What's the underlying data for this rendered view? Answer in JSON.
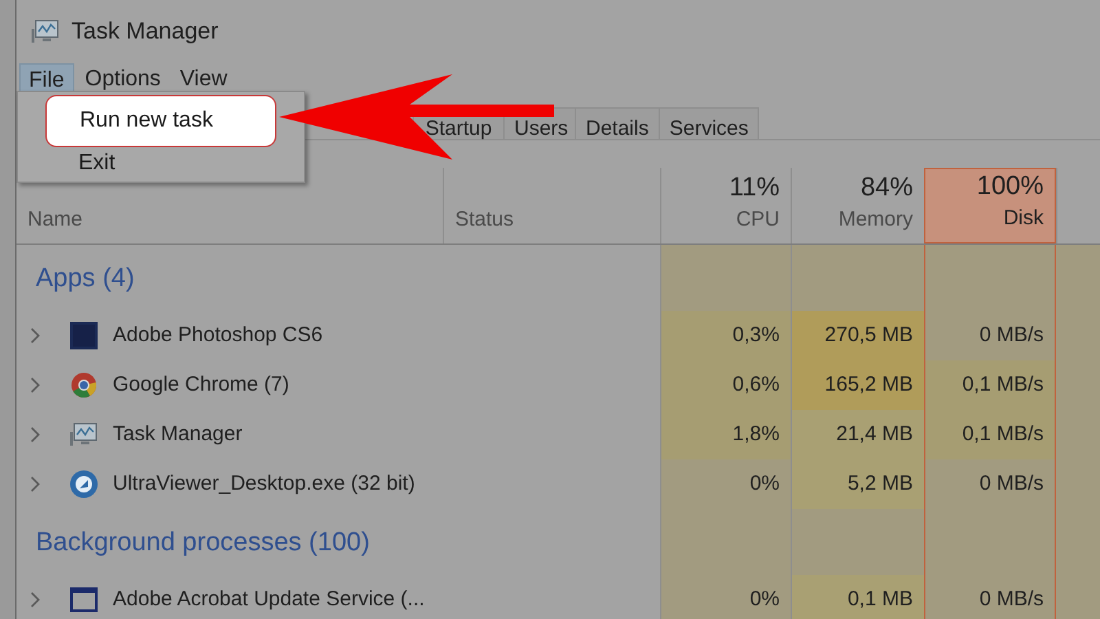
{
  "window": {
    "title": "Task Manager"
  },
  "menu_bar": [
    {
      "label": "File",
      "selected": true
    },
    {
      "label": "Options",
      "selected": false
    },
    {
      "label": "View",
      "selected": false
    }
  ],
  "file_menu": [
    {
      "label": "Run new task",
      "selected": true
    },
    {
      "label": "Exit",
      "selected": false
    }
  ],
  "tabs": [
    {
      "label": "Startup",
      "selected": false
    },
    {
      "label": "Users",
      "selected": false
    },
    {
      "label": "Details",
      "selected": false
    },
    {
      "label": "Services",
      "selected": false
    }
  ],
  "columns": [
    {
      "label": "Name",
      "selected": false
    },
    {
      "label": "Status",
      "selected": false
    },
    {
      "usage": "11%",
      "label": "CPU",
      "selected": false
    },
    {
      "usage": "84%",
      "label": "Memory",
      "selected": false
    },
    {
      "usage": "100%",
      "label": "Disk",
      "selected": true
    }
  ],
  "groups": [
    {
      "title": "Apps (4)",
      "rows": [
        {
          "kind": "photoshop",
          "name": "Adobe Photoshop CS6",
          "cells": [
            {
              "text": "0,3%",
              "color": "#a69d72"
            },
            {
              "text": "270,5 MB",
              "color": "#b09c5a"
            },
            {
              "text": "0 MB/s",
              "color": "#a29b80"
            }
          ]
        },
        {
          "kind": "chrome",
          "name": "Google Chrome (7)",
          "cells": [
            {
              "text": "0,6%",
              "color": "#a69d72"
            },
            {
              "text": "165,2 MB",
              "color": "#b09c5a"
            },
            {
              "text": "0,1 MB/s",
              "color": "#a69d72"
            }
          ]
        },
        {
          "kind": "taskmanager",
          "name": "Task Manager",
          "cells": [
            {
              "text": "1,8%",
              "color": "#a69d72"
            },
            {
              "text": "21,4 MB",
              "color": "#a9a073"
            },
            {
              "text": "0,1 MB/s",
              "color": "#a69d72"
            }
          ]
        },
        {
          "kind": "ultraviewer",
          "name": "UltraViewer_Desktop.exe (32 bit)",
          "cells": [
            {
              "text": "0%",
              "color": "#a29b80"
            },
            {
              "text": "5,2 MB",
              "color": "#a9a073"
            },
            {
              "text": "0 MB/s",
              "color": "#a29b80"
            }
          ]
        }
      ]
    },
    {
      "title": "Background processes (100)",
      "rows": [
        {
          "kind": "window",
          "name": "Adobe Acrobat Update Service (...",
          "cells": [
            {
              "text": "0%",
              "color": "#a29b80"
            },
            {
              "text": "0,1 MB",
              "color": "#a9a073"
            },
            {
              "text": "0 MB/s",
              "color": "#a29b80"
            }
          ]
        }
      ]
    }
  ]
}
